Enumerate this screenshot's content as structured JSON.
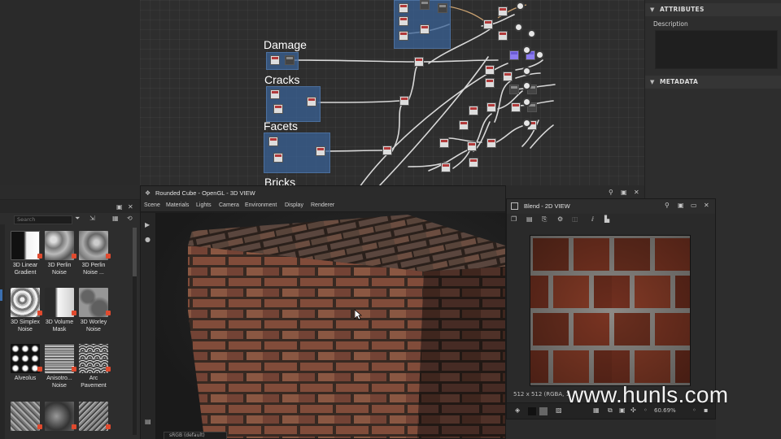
{
  "graph": {
    "frames": [
      {
        "title": "Damage"
      },
      {
        "title": "Cracks"
      },
      {
        "title": "Facets"
      },
      {
        "title": "Bricks"
      }
    ]
  },
  "attributes_panel": {
    "attributes_header": "ATTRIBUTES",
    "description_label": "Description",
    "metadata_header": "METADATA"
  },
  "library": {
    "search_placeholder": "Search",
    "items": [
      {
        "label_line1": "3D Linear",
        "label_line2": "Gradient"
      },
      {
        "label_line1": "3D Perlin",
        "label_line2": "Noise"
      },
      {
        "label_line1": "3D Perlin",
        "label_line2": "Noise ..."
      },
      {
        "label_line1": "3D Simplex",
        "label_line2": "Noise"
      },
      {
        "label_line1": "3D Volume",
        "label_line2": "Mask"
      },
      {
        "label_line1": "3D Worley",
        "label_line2": "Noise"
      },
      {
        "label_line1": "Alveolus",
        "label_line2": ""
      },
      {
        "label_line1": "Anisotro...",
        "label_line2": "Noise"
      },
      {
        "label_line1": "Arc",
        "label_line2": "Pavement"
      }
    ]
  },
  "view3d": {
    "title": "Rounded Cube - OpenGL - 3D VIEW",
    "menu": [
      "Scene",
      "Materials",
      "Lights",
      "Camera",
      "Environment",
      "Display",
      "Renderer"
    ],
    "colorspace": "sRGB (default)"
  },
  "view2d": {
    "title": "Blend - 2D VIEW",
    "info": "512 x 512 (RGBA, 1",
    "zoom": "60.69%"
  },
  "watermark": "www.hunls.com",
  "colors": {
    "frame_blue": "#3a6296",
    "accent_red": "#e04a2e",
    "node_purple": "#8c7cf0"
  }
}
